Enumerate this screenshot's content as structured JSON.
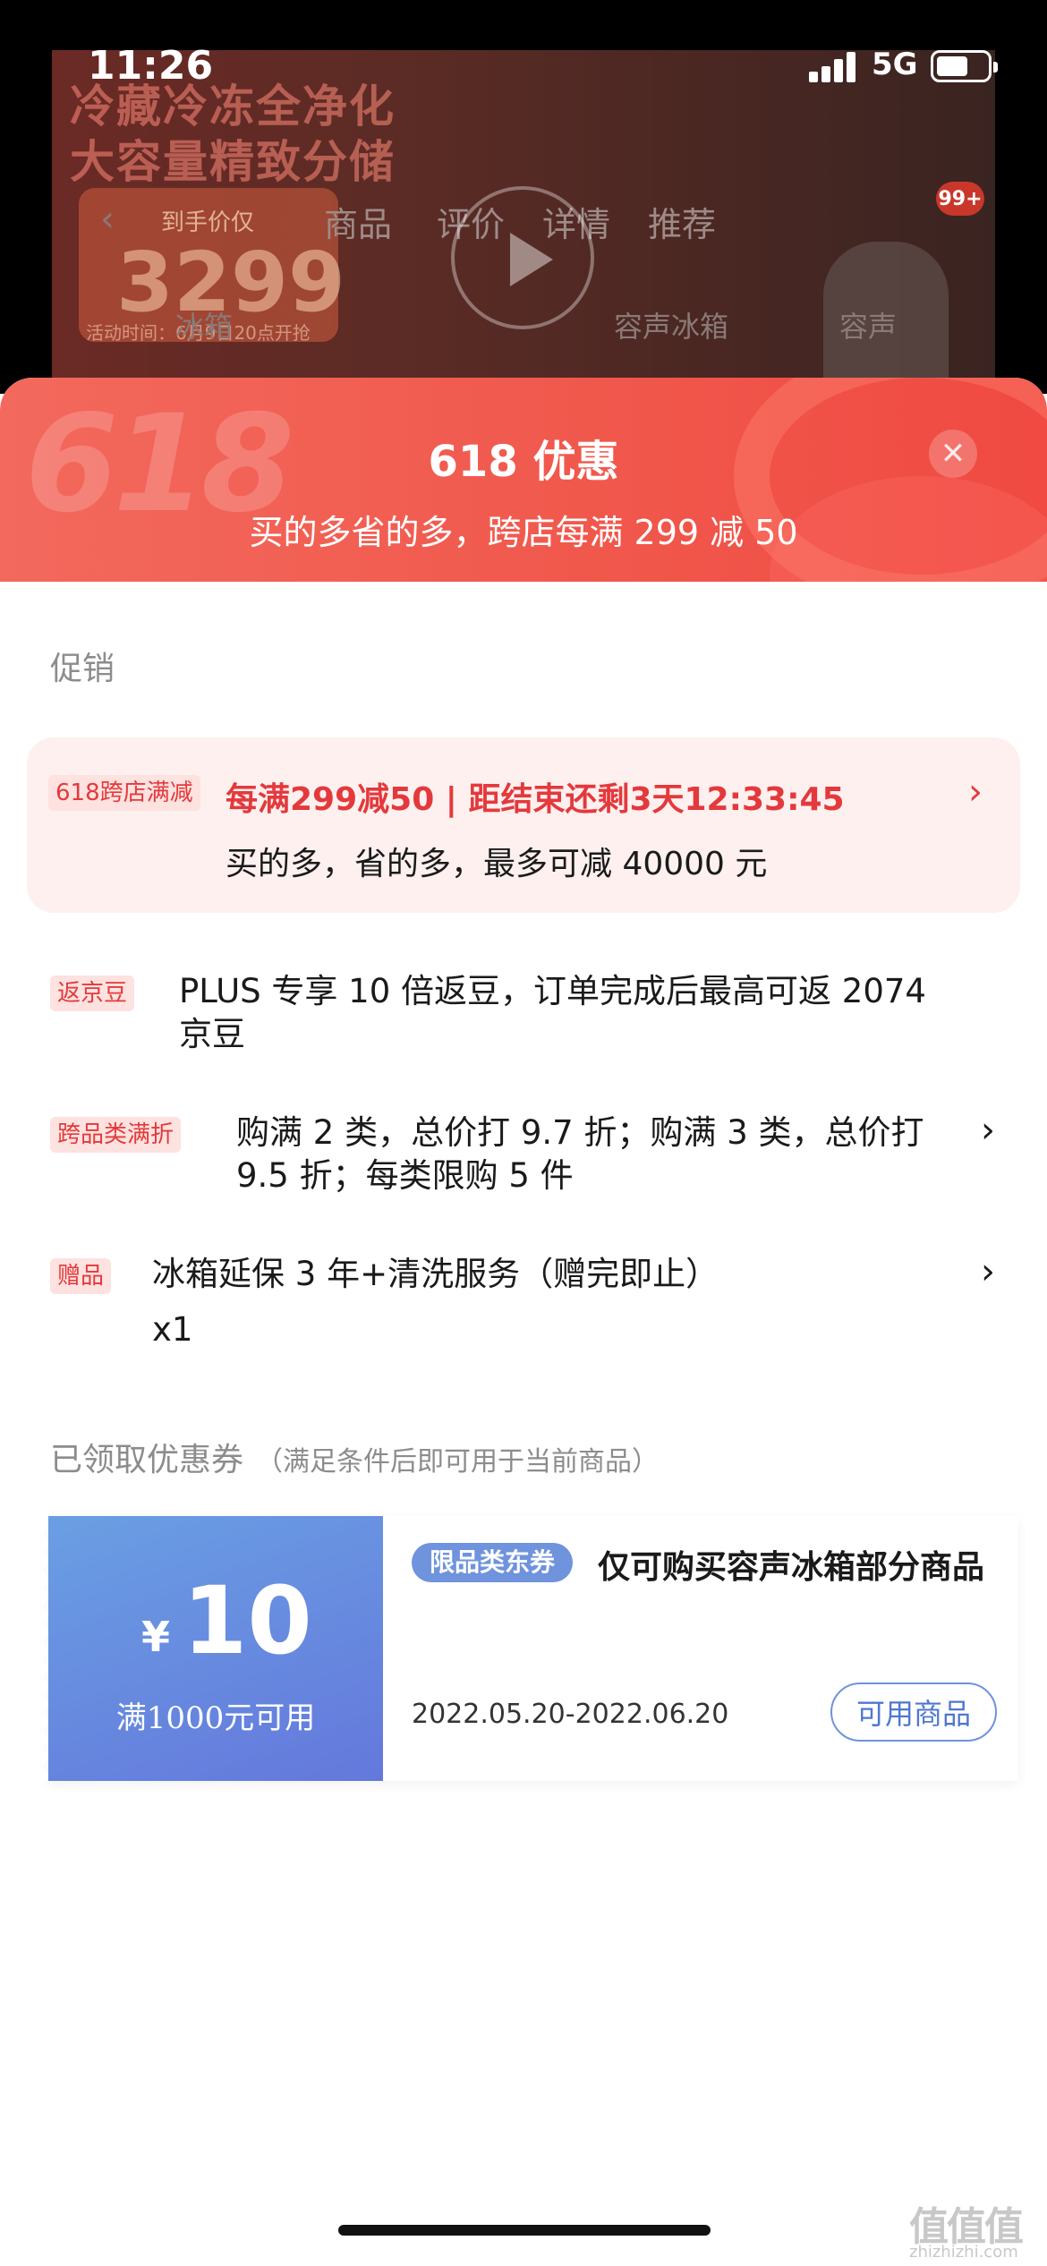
{
  "status_bar": {
    "time": "11:26",
    "network": "5G"
  },
  "background_page": {
    "hero_title_line1": "冷藏冷冻全净化",
    "hero_title_line2": "大容量精致分储",
    "price_label": "到手价仅",
    "price": "3299",
    "activity_time": "活动时间：6月9日20点开抢",
    "tabs": [
      "商品",
      "评价",
      "详情",
      "推荐"
    ],
    "cart_badge": "99+",
    "subtitle_left": "冰箱",
    "subtitle_mid": "容声冰箱",
    "subtitle_right": "容声"
  },
  "sheet": {
    "title": "618 优惠",
    "subtitle": "买的多省的多，跨店每满 299 减 50",
    "close_icon": "close-icon"
  },
  "promotions": {
    "section_title": "促销",
    "highlight": {
      "tag": "618跨店满减",
      "main": "每满299减50 | 距结束还剩3天12:33:45",
      "sub": "买的多，省的多，最多可减 40000 元"
    },
    "items": [
      {
        "tag": "返京豆",
        "line1": "PLUS 专享 10 倍返豆，订单完成后最高可返 2074",
        "line2": "京豆"
      },
      {
        "tag": "跨品类满折",
        "line1": "购满 2 类，总价打 9.7 折；购满 3 类，总价打",
        "line2": "9.5 折；每类限购 5 件"
      },
      {
        "tag": "赠品",
        "line1": "冰箱延保 3 年+清洗服务（赠完即止）",
        "line2": "x1"
      }
    ]
  },
  "coupons": {
    "section_title": "已领取优惠券",
    "section_note": "（满足条件后即可用于当前商品）",
    "coupon": {
      "currency": "¥",
      "amount": "10",
      "condition": "满1000元可用",
      "tag": "限品类东券",
      "title": "仅可购买容声冰箱部分商品",
      "date": "2022.05.20-2022.06.20",
      "button": "可用商品"
    }
  },
  "watermark": {
    "logo": "值值值",
    "url": "zhizhizhi.com"
  },
  "colors": {
    "accent_red": "#e4393c",
    "header_red": "#f15a4e",
    "coupon_blue": "#6478dc"
  }
}
